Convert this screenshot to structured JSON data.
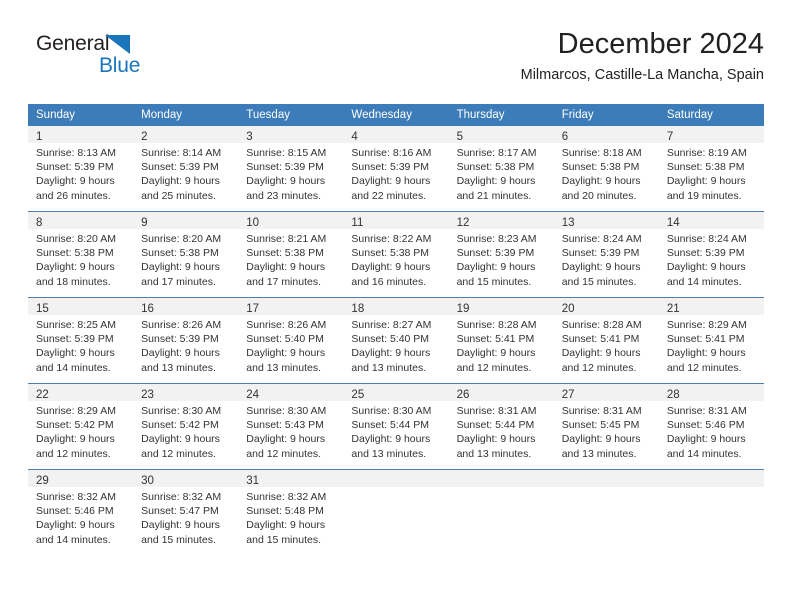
{
  "brand": {
    "name_dark": "General",
    "name_blue": "Blue",
    "dark_color": "#231f20",
    "blue_color": "#1a75bb"
  },
  "header": {
    "month_title": "December 2024",
    "location": "Milmarcos, Castille-La Mancha, Spain"
  },
  "theme": {
    "header_row_bg": "#3c7cb8",
    "daynum_band_bg": "#f2f2f2",
    "row_separator": "#4a7fb5",
    "text_color": "#333333"
  },
  "weekday_headers": [
    "Sunday",
    "Monday",
    "Tuesday",
    "Wednesday",
    "Thursday",
    "Friday",
    "Saturday"
  ],
  "weeks": [
    [
      {
        "day": "1",
        "sunrise": "Sunrise: 8:13 AM",
        "sunset": "Sunset: 5:39 PM",
        "daylight1": "Daylight: 9 hours",
        "daylight2": "and 26 minutes."
      },
      {
        "day": "2",
        "sunrise": "Sunrise: 8:14 AM",
        "sunset": "Sunset: 5:39 PM",
        "daylight1": "Daylight: 9 hours",
        "daylight2": "and 25 minutes."
      },
      {
        "day": "3",
        "sunrise": "Sunrise: 8:15 AM",
        "sunset": "Sunset: 5:39 PM",
        "daylight1": "Daylight: 9 hours",
        "daylight2": "and 23 minutes."
      },
      {
        "day": "4",
        "sunrise": "Sunrise: 8:16 AM",
        "sunset": "Sunset: 5:39 PM",
        "daylight1": "Daylight: 9 hours",
        "daylight2": "and 22 minutes."
      },
      {
        "day": "5",
        "sunrise": "Sunrise: 8:17 AM",
        "sunset": "Sunset: 5:38 PM",
        "daylight1": "Daylight: 9 hours",
        "daylight2": "and 21 minutes."
      },
      {
        "day": "6",
        "sunrise": "Sunrise: 8:18 AM",
        "sunset": "Sunset: 5:38 PM",
        "daylight1": "Daylight: 9 hours",
        "daylight2": "and 20 minutes."
      },
      {
        "day": "7",
        "sunrise": "Sunrise: 8:19 AM",
        "sunset": "Sunset: 5:38 PM",
        "daylight1": "Daylight: 9 hours",
        "daylight2": "and 19 minutes."
      }
    ],
    [
      {
        "day": "8",
        "sunrise": "Sunrise: 8:20 AM",
        "sunset": "Sunset: 5:38 PM",
        "daylight1": "Daylight: 9 hours",
        "daylight2": "and 18 minutes."
      },
      {
        "day": "9",
        "sunrise": "Sunrise: 8:20 AM",
        "sunset": "Sunset: 5:38 PM",
        "daylight1": "Daylight: 9 hours",
        "daylight2": "and 17 minutes."
      },
      {
        "day": "10",
        "sunrise": "Sunrise: 8:21 AM",
        "sunset": "Sunset: 5:38 PM",
        "daylight1": "Daylight: 9 hours",
        "daylight2": "and 17 minutes."
      },
      {
        "day": "11",
        "sunrise": "Sunrise: 8:22 AM",
        "sunset": "Sunset: 5:38 PM",
        "daylight1": "Daylight: 9 hours",
        "daylight2": "and 16 minutes."
      },
      {
        "day": "12",
        "sunrise": "Sunrise: 8:23 AM",
        "sunset": "Sunset: 5:39 PM",
        "daylight1": "Daylight: 9 hours",
        "daylight2": "and 15 minutes."
      },
      {
        "day": "13",
        "sunrise": "Sunrise: 8:24 AM",
        "sunset": "Sunset: 5:39 PM",
        "daylight1": "Daylight: 9 hours",
        "daylight2": "and 15 minutes."
      },
      {
        "day": "14",
        "sunrise": "Sunrise: 8:24 AM",
        "sunset": "Sunset: 5:39 PM",
        "daylight1": "Daylight: 9 hours",
        "daylight2": "and 14 minutes."
      }
    ],
    [
      {
        "day": "15",
        "sunrise": "Sunrise: 8:25 AM",
        "sunset": "Sunset: 5:39 PM",
        "daylight1": "Daylight: 9 hours",
        "daylight2": "and 14 minutes."
      },
      {
        "day": "16",
        "sunrise": "Sunrise: 8:26 AM",
        "sunset": "Sunset: 5:39 PM",
        "daylight1": "Daylight: 9 hours",
        "daylight2": "and 13 minutes."
      },
      {
        "day": "17",
        "sunrise": "Sunrise: 8:26 AM",
        "sunset": "Sunset: 5:40 PM",
        "daylight1": "Daylight: 9 hours",
        "daylight2": "and 13 minutes."
      },
      {
        "day": "18",
        "sunrise": "Sunrise: 8:27 AM",
        "sunset": "Sunset: 5:40 PM",
        "daylight1": "Daylight: 9 hours",
        "daylight2": "and 13 minutes."
      },
      {
        "day": "19",
        "sunrise": "Sunrise: 8:28 AM",
        "sunset": "Sunset: 5:41 PM",
        "daylight1": "Daylight: 9 hours",
        "daylight2": "and 12 minutes."
      },
      {
        "day": "20",
        "sunrise": "Sunrise: 8:28 AM",
        "sunset": "Sunset: 5:41 PM",
        "daylight1": "Daylight: 9 hours",
        "daylight2": "and 12 minutes."
      },
      {
        "day": "21",
        "sunrise": "Sunrise: 8:29 AM",
        "sunset": "Sunset: 5:41 PM",
        "daylight1": "Daylight: 9 hours",
        "daylight2": "and 12 minutes."
      }
    ],
    [
      {
        "day": "22",
        "sunrise": "Sunrise: 8:29 AM",
        "sunset": "Sunset: 5:42 PM",
        "daylight1": "Daylight: 9 hours",
        "daylight2": "and 12 minutes."
      },
      {
        "day": "23",
        "sunrise": "Sunrise: 8:30 AM",
        "sunset": "Sunset: 5:42 PM",
        "daylight1": "Daylight: 9 hours",
        "daylight2": "and 12 minutes."
      },
      {
        "day": "24",
        "sunrise": "Sunrise: 8:30 AM",
        "sunset": "Sunset: 5:43 PM",
        "daylight1": "Daylight: 9 hours",
        "daylight2": "and 12 minutes."
      },
      {
        "day": "25",
        "sunrise": "Sunrise: 8:30 AM",
        "sunset": "Sunset: 5:44 PM",
        "daylight1": "Daylight: 9 hours",
        "daylight2": "and 13 minutes."
      },
      {
        "day": "26",
        "sunrise": "Sunrise: 8:31 AM",
        "sunset": "Sunset: 5:44 PM",
        "daylight1": "Daylight: 9 hours",
        "daylight2": "and 13 minutes."
      },
      {
        "day": "27",
        "sunrise": "Sunrise: 8:31 AM",
        "sunset": "Sunset: 5:45 PM",
        "daylight1": "Daylight: 9 hours",
        "daylight2": "and 13 minutes."
      },
      {
        "day": "28",
        "sunrise": "Sunrise: 8:31 AM",
        "sunset": "Sunset: 5:46 PM",
        "daylight1": "Daylight: 9 hours",
        "daylight2": "and 14 minutes."
      }
    ],
    [
      {
        "day": "29",
        "sunrise": "Sunrise: 8:32 AM",
        "sunset": "Sunset: 5:46 PM",
        "daylight1": "Daylight: 9 hours",
        "daylight2": "and 14 minutes."
      },
      {
        "day": "30",
        "sunrise": "Sunrise: 8:32 AM",
        "sunset": "Sunset: 5:47 PM",
        "daylight1": "Daylight: 9 hours",
        "daylight2": "and 15 minutes."
      },
      {
        "day": "31",
        "sunrise": "Sunrise: 8:32 AM",
        "sunset": "Sunset: 5:48 PM",
        "daylight1": "Daylight: 9 hours",
        "daylight2": "and 15 minutes."
      },
      {
        "day": "",
        "sunrise": "",
        "sunset": "",
        "daylight1": "",
        "daylight2": ""
      },
      {
        "day": "",
        "sunrise": "",
        "sunset": "",
        "daylight1": "",
        "daylight2": ""
      },
      {
        "day": "",
        "sunrise": "",
        "sunset": "",
        "daylight1": "",
        "daylight2": ""
      },
      {
        "day": "",
        "sunrise": "",
        "sunset": "",
        "daylight1": "",
        "daylight2": ""
      }
    ]
  ]
}
